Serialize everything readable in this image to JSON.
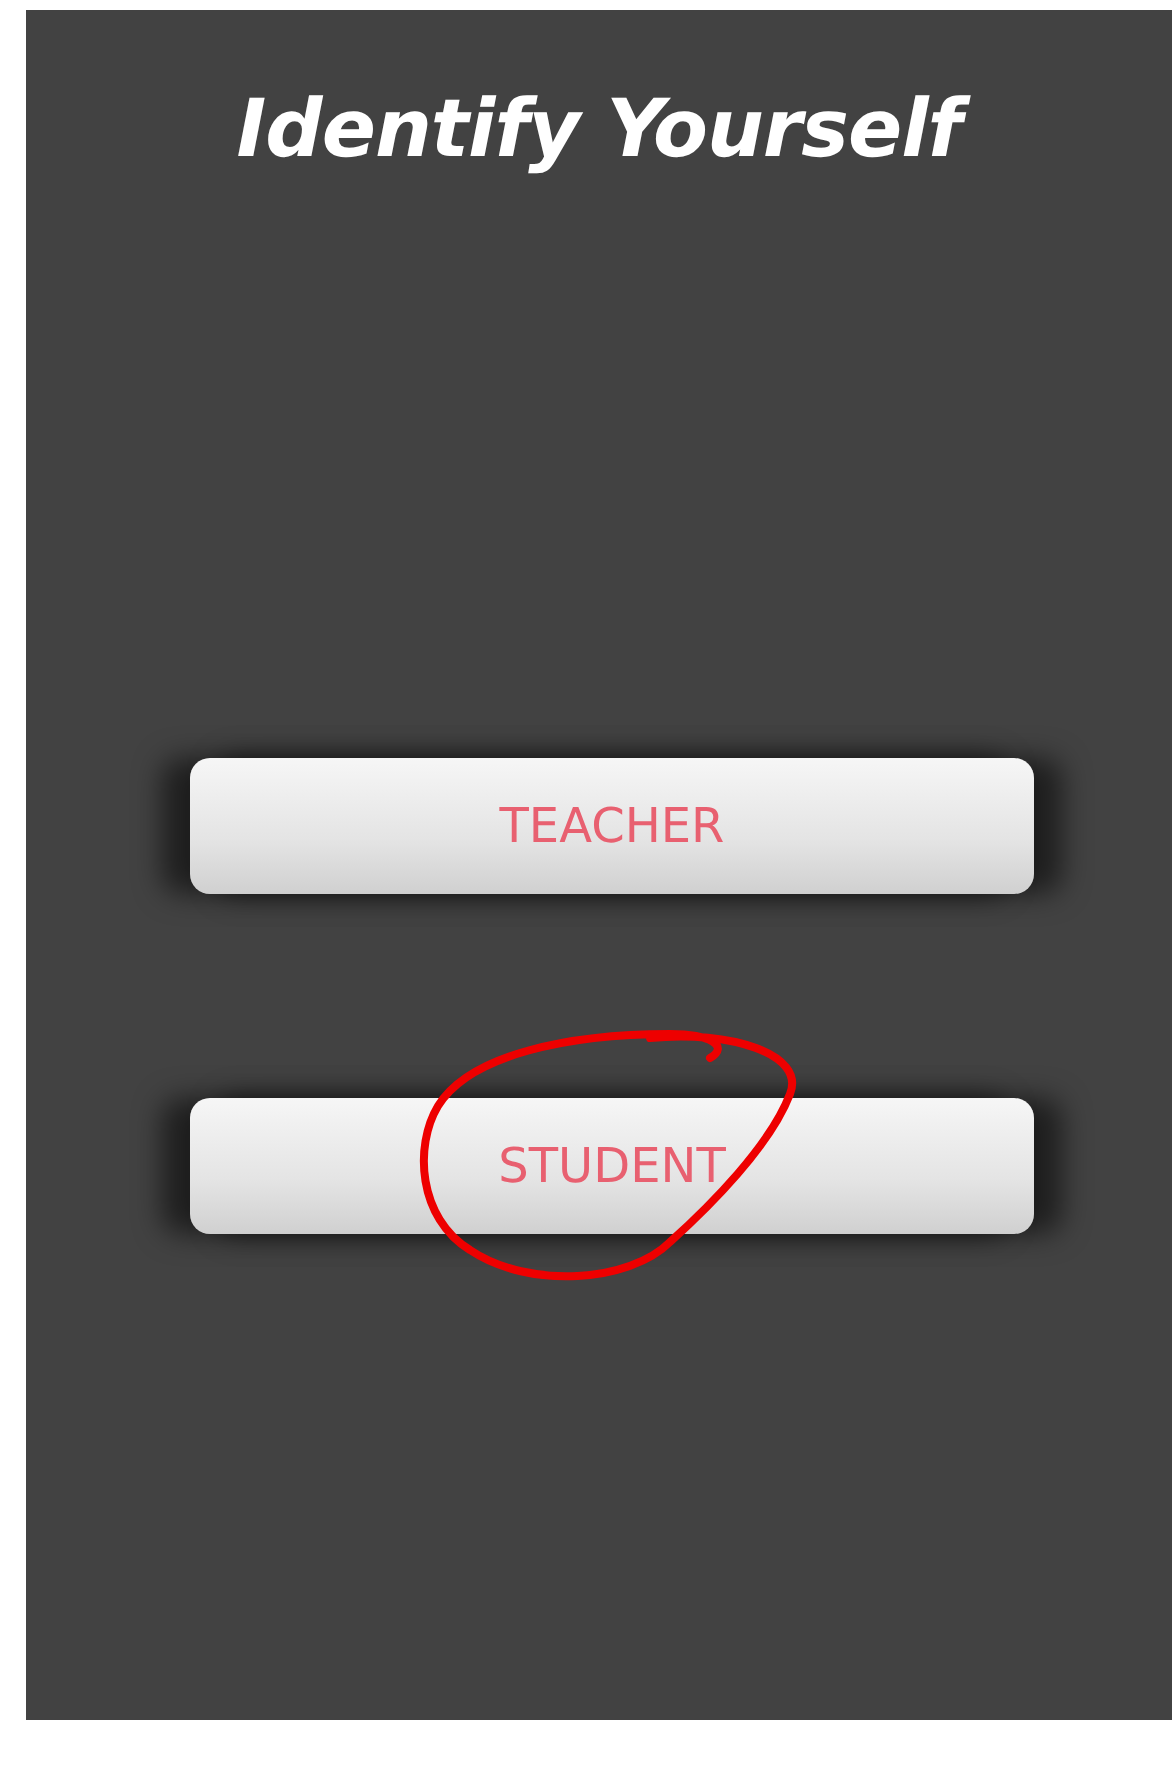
{
  "title": "Identify Yourself",
  "buttons": [
    {
      "label": "TEACHER",
      "circled": false
    },
    {
      "label": "STUDENT",
      "circled": true
    }
  ]
}
